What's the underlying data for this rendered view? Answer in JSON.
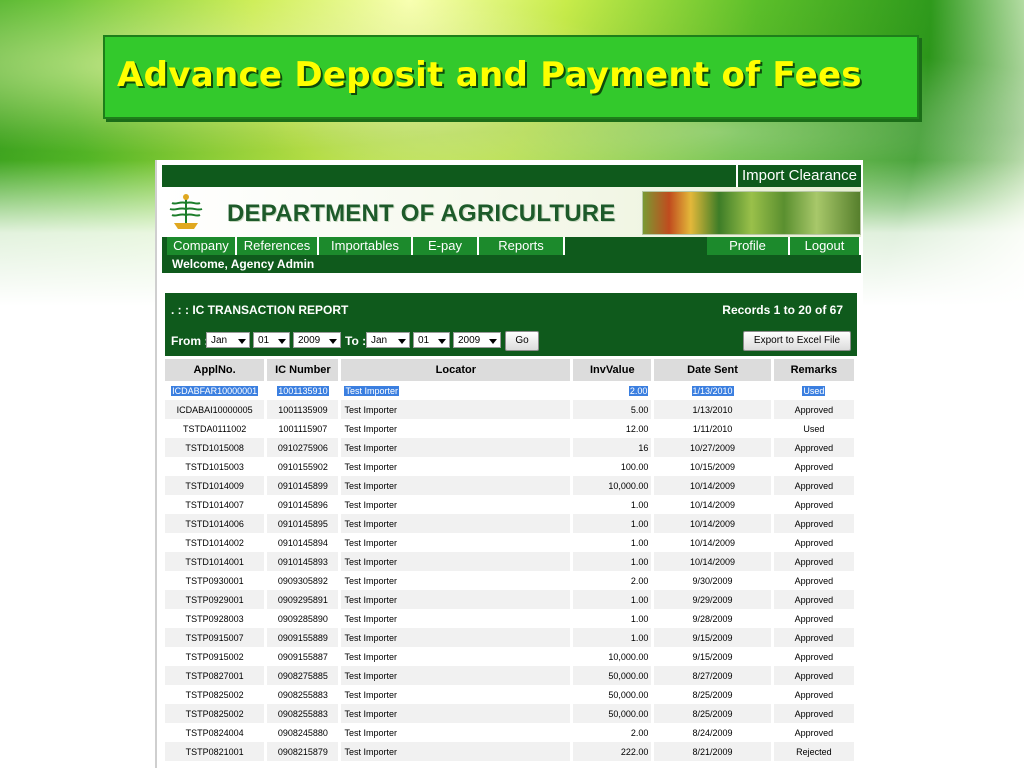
{
  "slide": {
    "title": "Advance Deposit and Payment of Fees"
  },
  "app": {
    "top_tab": "Import Clearance",
    "dept_name": "DEPARTMENT OF AGRICULTURE",
    "nav": {
      "left": [
        "Company",
        "References",
        "Importables",
        "E-pay",
        "Reports"
      ],
      "right": [
        "Profile",
        "Logout"
      ]
    },
    "welcome": "Welcome, Agency Admin",
    "report": {
      "title": ". : : IC TRANSACTION REPORT",
      "records": "Records 1 to 20 of 67",
      "from_label": "From :",
      "to_label": "To :",
      "from": {
        "month": "Jan",
        "day": "01",
        "year": "2009"
      },
      "to": {
        "month": "Jan",
        "day": "01",
        "year": "2009"
      },
      "go_label": "Go",
      "export_label": "Export to Excel File"
    },
    "table": {
      "headers": [
        "ApplNo.",
        "IC Number",
        "Locator",
        "InvValue",
        "Date Sent",
        "Remarks"
      ],
      "rows": [
        [
          "ICDABFAR10000001",
          "1001135910",
          "Test Importer",
          "2.00",
          "1/13/2010",
          "Used"
        ],
        [
          "ICDABAI10000005",
          "1001135909",
          "Test Importer",
          "5.00",
          "1/13/2010",
          "Approved"
        ],
        [
          "TSTDA0111002",
          "1001115907",
          "Test Importer",
          "12.00",
          "1/11/2010",
          "Used"
        ],
        [
          "TSTD1015008",
          "0910275906",
          "Test Importer",
          "16",
          "10/27/2009",
          "Approved"
        ],
        [
          "TSTD1015003",
          "0910155902",
          "Test Importer",
          "100.00",
          "10/15/2009",
          "Approved"
        ],
        [
          "TSTD1014009",
          "0910145899",
          "Test Importer",
          "10,000.00",
          "10/14/2009",
          "Approved"
        ],
        [
          "TSTD1014007",
          "0910145896",
          "Test Importer",
          "1.00",
          "10/14/2009",
          "Approved"
        ],
        [
          "TSTD1014006",
          "0910145895",
          "Test Importer",
          "1.00",
          "10/14/2009",
          "Approved"
        ],
        [
          "TSTD1014002",
          "0910145894",
          "Test Importer",
          "1.00",
          "10/14/2009",
          "Approved"
        ],
        [
          "TSTD1014001",
          "0910145893",
          "Test Importer",
          "1.00",
          "10/14/2009",
          "Approved"
        ],
        [
          "TSTP0930001",
          "0909305892",
          "Test Importer",
          "2.00",
          "9/30/2009",
          "Approved"
        ],
        [
          "TSTP0929001",
          "0909295891",
          "Test Importer",
          "1.00",
          "9/29/2009",
          "Approved"
        ],
        [
          "TSTP0928003",
          "0909285890",
          "Test Importer",
          "1.00",
          "9/28/2009",
          "Approved"
        ],
        [
          "TSTP0915007",
          "0909155889",
          "Test Importer",
          "1.00",
          "9/15/2009",
          "Approved"
        ],
        [
          "TSTP0915002",
          "0909155887",
          "Test Importer",
          "10,000.00",
          "9/15/2009",
          "Approved"
        ],
        [
          "TSTP0827001",
          "0908275885",
          "Test Importer",
          "50,000.00",
          "8/27/2009",
          "Approved"
        ],
        [
          "TSTP0825002",
          "0908255883",
          "Test Importer",
          "50,000.00",
          "8/25/2009",
          "Approved"
        ],
        [
          "TSTP0825002",
          "0908255883",
          "Test Importer",
          "50,000.00",
          "8/25/2009",
          "Approved"
        ],
        [
          "TSTP0824004",
          "0908245880",
          "Test Importer",
          "2.00",
          "8/24/2009",
          "Approved"
        ],
        [
          "TSTP0821001",
          "0908215879",
          "Test Importer",
          "222.00",
          "8/21/2009",
          "Rejected"
        ]
      ],
      "selected_row": 0
    }
  },
  "colors": {
    "title_bg": "#33c92c",
    "title_text": "#ffff00",
    "app_dark_green": "#0f5a1c",
    "nav_green": "#1c8a2c",
    "selection_blue": "#3b7fe0"
  }
}
